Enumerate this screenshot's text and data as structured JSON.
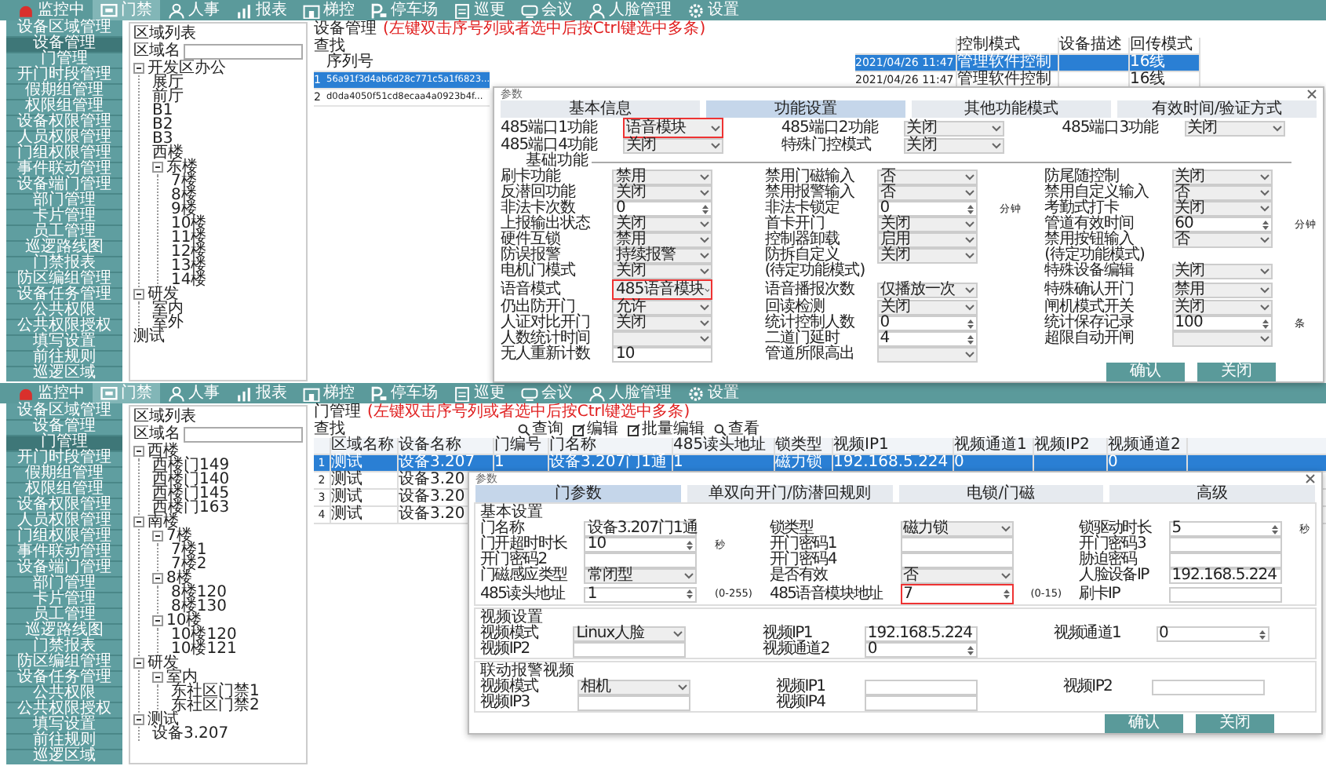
{
  "screens": [
    {
      "kind": "device",
      "nav": [
        {
          "label": "监控中",
          "selected": false
        },
        {
          "label": "门禁",
          "selected": true
        },
        {
          "label": "人事",
          "selected": false
        },
        {
          "label": "报表",
          "selected": false
        },
        {
          "label": "梯控",
          "selected": false
        },
        {
          "label": "停车场",
          "selected": false
        },
        {
          "label": "巡更",
          "selected": false
        },
        {
          "label": "会议",
          "selected": false
        },
        {
          "label": "人脸管理",
          "selected": false
        },
        {
          "label": "设置",
          "selected": false
        }
      ],
      "sidebar": [
        {
          "label": "设备区域管理",
          "selected": false
        },
        {
          "label": "设备管理",
          "selected": true
        },
        {
          "label": "门管理",
          "selected": false
        },
        {
          "label": "开门时段管理",
          "selected": false
        },
        {
          "label": "假期组管理",
          "selected": false
        },
        {
          "label": "权限组管理",
          "selected": false
        },
        {
          "label": "设备权限管理",
          "selected": false
        },
        {
          "label": "人员权限管理",
          "selected": false
        },
        {
          "label": "门组权限管理",
          "selected": false
        },
        {
          "label": "事件联动管理",
          "selected": false
        },
        {
          "label": "设备端门管理",
          "selected": false
        },
        {
          "label": "部门管理",
          "selected": false
        },
        {
          "label": "卡片管理",
          "selected": false
        },
        {
          "label": "员工管理",
          "selected": false
        },
        {
          "label": "巡逻路线图",
          "selected": false
        },
        {
          "label": "门禁报表",
          "selected": false
        },
        {
          "label": "防区编组管理",
          "selected": false
        },
        {
          "label": "设备任务管理",
          "selected": false
        },
        {
          "label": "公共权限",
          "selected": false
        },
        {
          "label": "公共权限授权",
          "selected": false
        },
        {
          "label": "填写设置",
          "selected": false
        },
        {
          "label": "前往规则",
          "selected": false
        },
        {
          "label": "巡逻区域",
          "selected": false
        }
      ],
      "tree": {
        "title": "区域列表",
        "search_label": "区域名",
        "nodes": [
          {
            "label": "开发区办公",
            "expanded": true,
            "children": [
              {
                "label": "展厅"
              },
              {
                "label": "前厅"
              },
              {
                "label": "B1"
              },
              {
                "label": "B2"
              },
              {
                "label": "B3"
              },
              {
                "label": "西楼"
              },
              {
                "label": "东楼",
                "expanded": true,
                "children": [
                  {
                    "label": "7楼"
                  },
                  {
                    "label": "8楼"
                  },
                  {
                    "label": "9楼"
                  },
                  {
                    "label": "10楼"
                  },
                  {
                    "label": "11楼"
                  },
                  {
                    "label": "12楼"
                  },
                  {
                    "label": "13楼"
                  },
                  {
                    "label": "14楼"
                  }
                ]
              }
            ]
          },
          {
            "label": "研发",
            "expanded": true,
            "children": [
              {
                "label": "室内"
              },
              {
                "label": "室外"
              }
            ]
          },
          {
            "label": "测试"
          }
        ]
      },
      "panel": {
        "breadcrumb": "设备管理",
        "note": "(左键双击序号列或者选中后按Ctrl键选中多条)",
        "find_label": "查找",
        "column": "序列号",
        "rows": [
          {
            "no": "1",
            "serial": "56a91f3d4ab6d28c771c5a1f6823...",
            "selected": true
          },
          {
            "no": "2",
            "serial": "d0da4050f51cd8ecaa4a0923b4f...",
            "selected": false
          }
        ]
      },
      "dialog": {
        "title": "参数",
        "tabs": [
          {
            "label": "基本信息",
            "selected": false
          },
          {
            "label": "功能设置",
            "selected": true
          },
          {
            "label": "其他功能模式",
            "selected": false
          },
          {
            "label": "有效时间/验证方式",
            "selected": false
          }
        ],
        "sections": [
          {
            "kind": "plain",
            "fields": [
              {
                "label": "485端口1功能",
                "kind": "select",
                "value": "语音模块",
                "highlight": true
              },
              {
                "label": "485端口2功能",
                "kind": "select",
                "value": "关闭",
                "highlight": false
              },
              {
                "label": "485端口3功能",
                "kind": "select",
                "value": "关闭",
                "highlight": false
              },
              {
                "label": "485端口4功能",
                "kind": "select",
                "value": "关闭",
                "highlight": false
              },
              {
                "label": "特殊门控模式",
                "kind": "select",
                "value": "关闭",
                "highlight": false
              }
            ]
          },
          {
            "kind": "divider",
            "title": "基础功能",
            "fields": [
              {
                "label": "刷卡功能",
                "kind": "select",
                "value": "禁用",
                "highlight": false
              },
              {
                "label": "禁用门磁输入",
                "kind": "select",
                "value": "否",
                "highlight": false
              },
              {
                "label": "防尾随控制",
                "kind": "select",
                "value": "关闭",
                "highlight": false
              },
              {
                "label": "反潜回功能",
                "kind": "select",
                "value": "关闭",
                "highlight": false
              },
              {
                "label": "禁用报警输入",
                "kind": "select",
                "value": "否",
                "highlight": false
              },
              {
                "label": "禁用自定义输入",
                "kind": "select",
                "value": "否",
                "highlight": false
              },
              {
                "label": "非法卡次数",
                "kind": "spin",
                "value": "0",
                "highlight": false
              },
              {
                "label": "非法卡锁定",
                "kind": "spin",
                "value": "0",
                "unit": "分钟",
                "highlight": false
              },
              {
                "label": "考勤式打卡",
                "kind": "select",
                "value": "关闭",
                "highlight": false
              },
              {
                "label": "上报输出状态",
                "kind": "select",
                "value": "关闭",
                "highlight": false
              },
              {
                "label": "首卡开门",
                "kind": "select",
                "value": "关闭",
                "highlight": false
              },
              {
                "label": "管道有效时间",
                "kind": "spin",
                "value": "60",
                "unit": "分钟",
                "highlight": false
              },
              {
                "label": "硬件互锁",
                "kind": "select",
                "value": "禁用",
                "highlight": false
              },
              {
                "label": "控制器卸载",
                "kind": "select",
                "value": "启用",
                "highlight": false
              },
              {
                "label": "禁用按钮输入",
                "kind": "select",
                "value": "否",
                "highlight": false
              },
              {
                "label": "防误报警",
                "kind": "select",
                "value": "持续报警",
                "highlight": false
              },
              {
                "label": "防拆自定义",
                "kind": "select",
                "value": "关闭",
                "highlight": false
              },
              {
                "label": "(待定功能模式)",
                "kind": "note",
                "highlight": false
              },
              {
                "label": "电机门模式",
                "kind": "select",
                "value": "关闭",
                "highlight": false
              },
              {
                "label": "(待定功能模式)",
                "kind": "note",
                "highlight": false
              },
              {
                "label": "特殊设备编辑",
                "kind": "select",
                "value": "关闭",
                "highlight": false
              },
              {
                "label": "语音模式",
                "kind": "select",
                "value": "485语音模块",
                "highlight": true
              },
              {
                "label": "语音播报次数",
                "kind": "select",
                "value": "仅播放一次",
                "highlight": false
              },
              {
                "label": "特殊确认开门",
                "kind": "select",
                "value": "禁用",
                "highlight": false
              },
              {
                "label": "仍出防开门",
                "kind": "select",
                "value": "允许",
                "highlight": false
              },
              {
                "label": "回读检测",
                "kind": "select",
                "value": "关闭",
                "highlight": false
              },
              {
                "label": "闸机模式开关",
                "kind": "select",
                "value": "关闭",
                "highlight": false
              },
              {
                "label": "人证对比开门",
                "kind": "select",
                "value": "关闭",
                "highlight": false
              },
              {
                "label": "统计控制人数",
                "kind": "spin",
                "value": "0",
                "highlight": false
              },
              {
                "label": "统计保存记录",
                "kind": "spin",
                "value": "100",
                "unit": "条",
                "highlight": false
              },
              {
                "label": "人数统计时间",
                "kind": "select",
                "highlight": false
              },
              {
                "label": "二道门延时",
                "kind": "spin",
                "value": "4",
                "highlight": false
              },
              {
                "label": "超限自动开闸",
                "kind": "select",
                "highlight": false
              },
              {
                "label": "无人重新计数",
                "kind": "text",
                "value": "10",
                "highlight": false
              },
              {
                "label": "管道所限高出",
                "kind": "select",
                "highlight": false
              }
            ]
          }
        ],
        "buttons": [
          "确认",
          "关闭"
        ]
      },
      "side_table": {
        "columns": [
          "",
          "控制模式",
          "设备描述",
          "回传模式"
        ],
        "rows": [
          {
            "cells": [
              "2021/04/26 11:47",
              "管理软件控制",
              "",
              "16线"
            ],
            "selected": true
          },
          {
            "cells": [
              "2021/04/26 11:47",
              "管理软件控制",
              "",
              "16线"
            ],
            "selected": false
          }
        ]
      }
    },
    {
      "kind": "door",
      "nav": [
        {
          "label": "监控中",
          "selected": false
        },
        {
          "label": "门禁",
          "selected": true
        },
        {
          "label": "人事",
          "selected": false
        },
        {
          "label": "报表",
          "selected": false
        },
        {
          "label": "梯控",
          "selected": false
        },
        {
          "label": "停车场",
          "selected": false
        },
        {
          "label": "巡更",
          "selected": false
        },
        {
          "label": "会议",
          "selected": false
        },
        {
          "label": "人脸管理",
          "selected": false
        },
        {
          "label": "设置",
          "selected": false
        }
      ],
      "sidebar": [
        {
          "label": "设备区域管理",
          "selected": false
        },
        {
          "label": "设备管理",
          "selected": false
        },
        {
          "label": "门管理",
          "selected": true
        },
        {
          "label": "开门时段管理",
          "selected": false
        },
        {
          "label": "假期组管理",
          "selected": false
        },
        {
          "label": "权限组管理",
          "selected": false
        },
        {
          "label": "设备权限管理",
          "selected": false
        },
        {
          "label": "人员权限管理",
          "selected": false
        },
        {
          "label": "门组权限管理",
          "selected": false
        },
        {
          "label": "事件联动管理",
          "selected": false
        },
        {
          "label": "设备端门管理",
          "selected": false
        },
        {
          "label": "部门管理",
          "selected": false
        },
        {
          "label": "卡片管理",
          "selected": false
        },
        {
          "label": "员工管理",
          "selected": false
        },
        {
          "label": "巡逻路线图",
          "selected": false
        },
        {
          "label": "门禁报表",
          "selected": false
        },
        {
          "label": "防区编组管理",
          "selected": false
        },
        {
          "label": "设备任务管理",
          "selected": false
        },
        {
          "label": "公共权限",
          "selected": false
        },
        {
          "label": "公共权限授权",
          "selected": false
        },
        {
          "label": "填写设置",
          "selected": false
        },
        {
          "label": "前往规则",
          "selected": false
        },
        {
          "label": "巡逻区域",
          "selected": false
        }
      ],
      "tree": {
        "title": "区域列表",
        "search_label": "区域名",
        "nodes": [
          {
            "label": "西楼",
            "expanded": true,
            "children": [
              {
                "label": "西楼门149"
              },
              {
                "label": "西楼门140"
              },
              {
                "label": "西楼门145"
              },
              {
                "label": "西楼门163"
              }
            ]
          },
          {
            "label": "南楼",
            "expanded": true,
            "children": [
              {
                "label": "7楼",
                "expanded": true,
                "children": [
                  {
                    "label": "7楼1"
                  },
                  {
                    "label": "7楼2"
                  }
                ]
              },
              {
                "label": "8楼",
                "expanded": true,
                "children": [
                  {
                    "label": "8楼120"
                  },
                  {
                    "label": "8楼130"
                  }
                ]
              },
              {
                "label": "10楼",
                "expanded": true,
                "children": [
                  {
                    "label": "10楼120"
                  },
                  {
                    "label": "10楼121"
                  }
                ]
              }
            ]
          },
          {
            "label": "研发",
            "expanded": true,
            "children": [
              {
                "label": "室内",
                "expanded": true,
                "children": [
                  {
                    "label": "东社区门禁1"
                  },
                  {
                    "label": "东社区门禁2"
                  }
                ]
              }
            ]
          },
          {
            "label": "测试",
            "expanded": true,
            "children": [
              {
                "label": "设备3.207"
              }
            ]
          }
        ]
      },
      "panel": {
        "breadcrumb": "门管理",
        "note": "(左键双击序号列或者选中后按Ctrl键选中多条)",
        "find_label": "查找",
        "toolbar": [
          {
            "label": "查询",
            "kind": "search"
          },
          {
            "label": "编辑",
            "kind": "edit"
          },
          {
            "label": "批量编辑",
            "kind": "edit"
          },
          {
            "label": "查看",
            "kind": "search"
          }
        ],
        "columns": [
          "区域名称",
          "设备名称",
          "门编号",
          "门名称",
          "485读头地址",
          "锁类型",
          "视频IP1",
          "视频通道1",
          "视频IP2",
          "视频通道2"
        ],
        "rows": [
          {
            "no": "1",
            "cells": [
              "测试",
              "设备3.207",
              "1",
              "设备3.207门1通",
              "1",
              "磁力锁",
              "192.168.5.224",
              "0",
              "",
              "0"
            ],
            "selected": true
          },
          {
            "no": "2",
            "cells": [
              "测试",
              "设备3.20"
            ],
            "selected": false
          },
          {
            "no": "3",
            "cells": [
              "测试",
              "设备3.20"
            ],
            "selected": false
          },
          {
            "no": "4",
            "cells": [
              "测试",
              "设备3.20"
            ],
            "selected": false
          }
        ]
      },
      "dialog": {
        "title": "参数",
        "tabs": [
          {
            "label": "门参数",
            "selected": true
          },
          {
            "label": "单双向开门/防潜回规则",
            "selected": false
          },
          {
            "label": "电锁/门磁",
            "selected": false
          },
          {
            "label": "高级",
            "selected": false
          }
        ],
        "sections": [
          {
            "kind": "group",
            "title": "基本设置",
            "fields": [
              {
                "label": "门名称",
                "kind": "text",
                "value": "设备3.207门1通",
                "highlight": false
              },
              {
                "label": "锁类型",
                "kind": "select",
                "value": "磁力锁",
                "highlight": false
              },
              {
                "label": "锁驱动时长",
                "kind": "spin",
                "value": "5",
                "unit": "秒",
                "highlight": false
              },
              {
                "label": "门开超时时长",
                "kind": "spin",
                "value": "10",
                "unit": "秒",
                "highlight": false
              },
              {
                "label": "开门密码1",
                "kind": "text",
                "highlight": false
              },
              {
                "label": "开门密码3",
                "kind": "text",
                "highlight": false
              },
              {
                "label": "开门密码2",
                "kind": "text",
                "highlight": false
              },
              {
                "label": "开门密码4",
                "kind": "text",
                "highlight": false
              },
              {
                "label": "胁迫密码",
                "kind": "text",
                "highlight": false
              },
              {
                "label": "门磁感应类型",
                "kind": "select",
                "value": "常闭型",
                "highlight": false
              },
              {
                "label": "是否有效",
                "kind": "select",
                "value": "否",
                "highlight": false
              },
              {
                "label": "人脸设备IP",
                "kind": "text",
                "value": "192.168.5.224",
                "highlight": false
              },
              {
                "label": "485读头地址",
                "kind": "spin",
                "value": "1",
                "unit": "(0-255)",
                "highlight": false
              },
              {
                "label": "485语音模块地址",
                "kind": "spin",
                "value": "7",
                "unit": "(0-15)",
                "highlight": true
              },
              {
                "label": "刷卡IP",
                "kind": "text",
                "highlight": false
              }
            ]
          },
          {
            "kind": "group",
            "title": "视频设置",
            "fields": [
              {
                "label": "视频模式",
                "kind": "select",
                "value": "Linux人脸",
                "highlight": false
              },
              {
                "label": "视频IP1",
                "kind": "text",
                "value": "192.168.5.224",
                "highlight": false
              },
              {
                "label": "视频通道1",
                "kind": "spin",
                "value": "0",
                "highlight": false
              },
              {
                "label": "视频IP2",
                "kind": "text",
                "highlight": false
              },
              {
                "label": "视频通道2",
                "kind": "spin",
                "value": "0",
                "highlight": false
              }
            ]
          },
          {
            "kind": "group",
            "title": "联动报警视频",
            "fields": [
              {
                "label": "视频模式",
                "kind": "select",
                "value": "相机",
                "highlight": false
              },
              {
                "label": "视频IP1",
                "kind": "text",
                "highlight": false
              },
              {
                "label": "视频IP2",
                "kind": "text",
                "highlight": false
              },
              {
                "label": "视频IP3",
                "kind": "text",
                "highlight": false
              },
              {
                "label": "视频IP4",
                "kind": "text",
                "highlight": false
              }
            ]
          }
        ],
        "buttons": [
          "确认",
          "关闭"
        ]
      }
    }
  ]
}
